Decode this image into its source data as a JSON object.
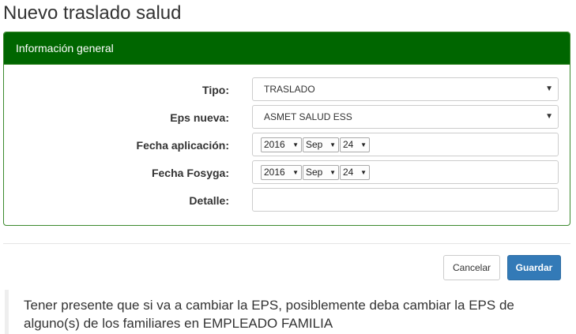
{
  "page": {
    "title": "Nuevo traslado salud"
  },
  "panel": {
    "heading": "Información general"
  },
  "form": {
    "tipo": {
      "label": "Tipo:",
      "value": "TRASLADO"
    },
    "eps_nueva": {
      "label": "Eps nueva:",
      "value": "ASMET SALUD ESS"
    },
    "fecha_aplicacion": {
      "label": "Fecha aplicación:",
      "year": "2016",
      "month": "Sep",
      "day": "24"
    },
    "fecha_fosyga": {
      "label": "Fecha Fosyga:",
      "year": "2016",
      "month": "Sep",
      "day": "24"
    },
    "detalle": {
      "label": "Detalle:",
      "value": ""
    }
  },
  "actions": {
    "cancel_label": "Cancelar",
    "save_label": "Guardar"
  },
  "note": {
    "text": "Tener presente que si va a cambiar la EPS, posiblemente deba cambiar la EPS de alguno(s) de los familiares en EMPLEADO FAMILIA"
  },
  "icons": {
    "dropdown": "▼",
    "mini_dropdown": "▼"
  },
  "colors": {
    "panel_header": "#006600",
    "panel_border": "#3c8a2e",
    "primary_button": "#337ab7"
  }
}
